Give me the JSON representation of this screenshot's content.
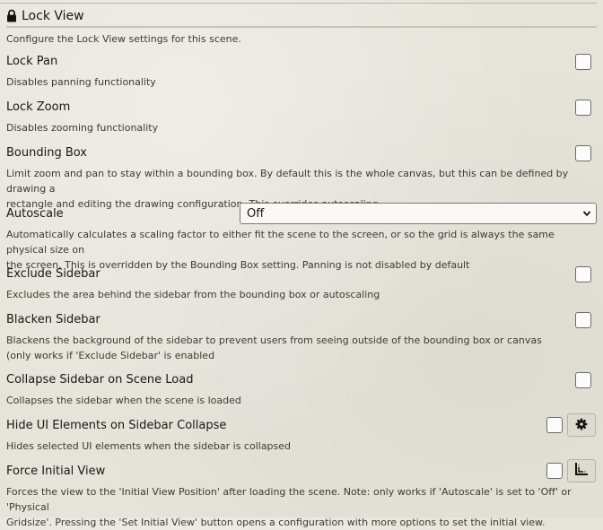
{
  "header": {
    "title": "Lock View",
    "icon": "lock-icon"
  },
  "intro": "Configure the Lock View settings for this scene.",
  "settings": {
    "lock_pan": {
      "label": "Lock Pan",
      "hint": "Disables panning functionality",
      "checked": false
    },
    "lock_zoom": {
      "label": "Lock Zoom",
      "hint": "Disables zooming functionality",
      "checked": false
    },
    "bounding_box": {
      "label": "Bounding Box",
      "hint_line1": "Limit zoom and pan to stay within a bounding box. By default this is the whole canvas, but this can be defined by drawing a",
      "hint_line2": "rectangle and editing the drawing configuration. This overrides autoscaling",
      "checked": false
    },
    "autoscale": {
      "label": "Autoscale",
      "value": "Off",
      "hint_line1": "Automatically calculates a scaling factor to either fit the scene to the screen, or so the grid is always the same physical size on",
      "hint_line2": "the screen. This is overridden by the Bounding Box setting. Panning is not disabled by default"
    },
    "exclude_sidebar": {
      "label": "Exclude Sidebar",
      "hint": "Excludes the area behind the sidebar from the bounding box or autoscaling",
      "checked": false
    },
    "blacken_sidebar": {
      "label": "Blacken Sidebar",
      "hint_line1": "Blackens the background of the sidebar to prevent users from seeing outside of the bounding box or canvas",
      "hint_line2": "(only works if 'Exclude Sidebar' is enabled",
      "checked": false
    },
    "collapse_sidebar": {
      "label": "Collapse Sidebar on Scene Load",
      "hint": "Collapses the sidebar when the scene is loaded",
      "checked": false
    },
    "hide_ui": {
      "label": "Hide UI Elements on Sidebar Collapse",
      "hint": "Hides selected UI elements when the sidebar is collapsed",
      "checked": false,
      "button_icon": "gear-icon"
    },
    "force_initial_view": {
      "label": "Force Initial View",
      "hint_line1": "Forces the view to the 'Initial View Position' after loading the scene. Note: only works if 'Autoscale' is set to 'Off' or 'Physical",
      "hint_line2": "Gridsize'. Pressing the 'Set Initial View' button opens a configuration with more options to set the initial view.",
      "checked": false,
      "button_icon": "set-initial-view-icon"
    }
  }
}
